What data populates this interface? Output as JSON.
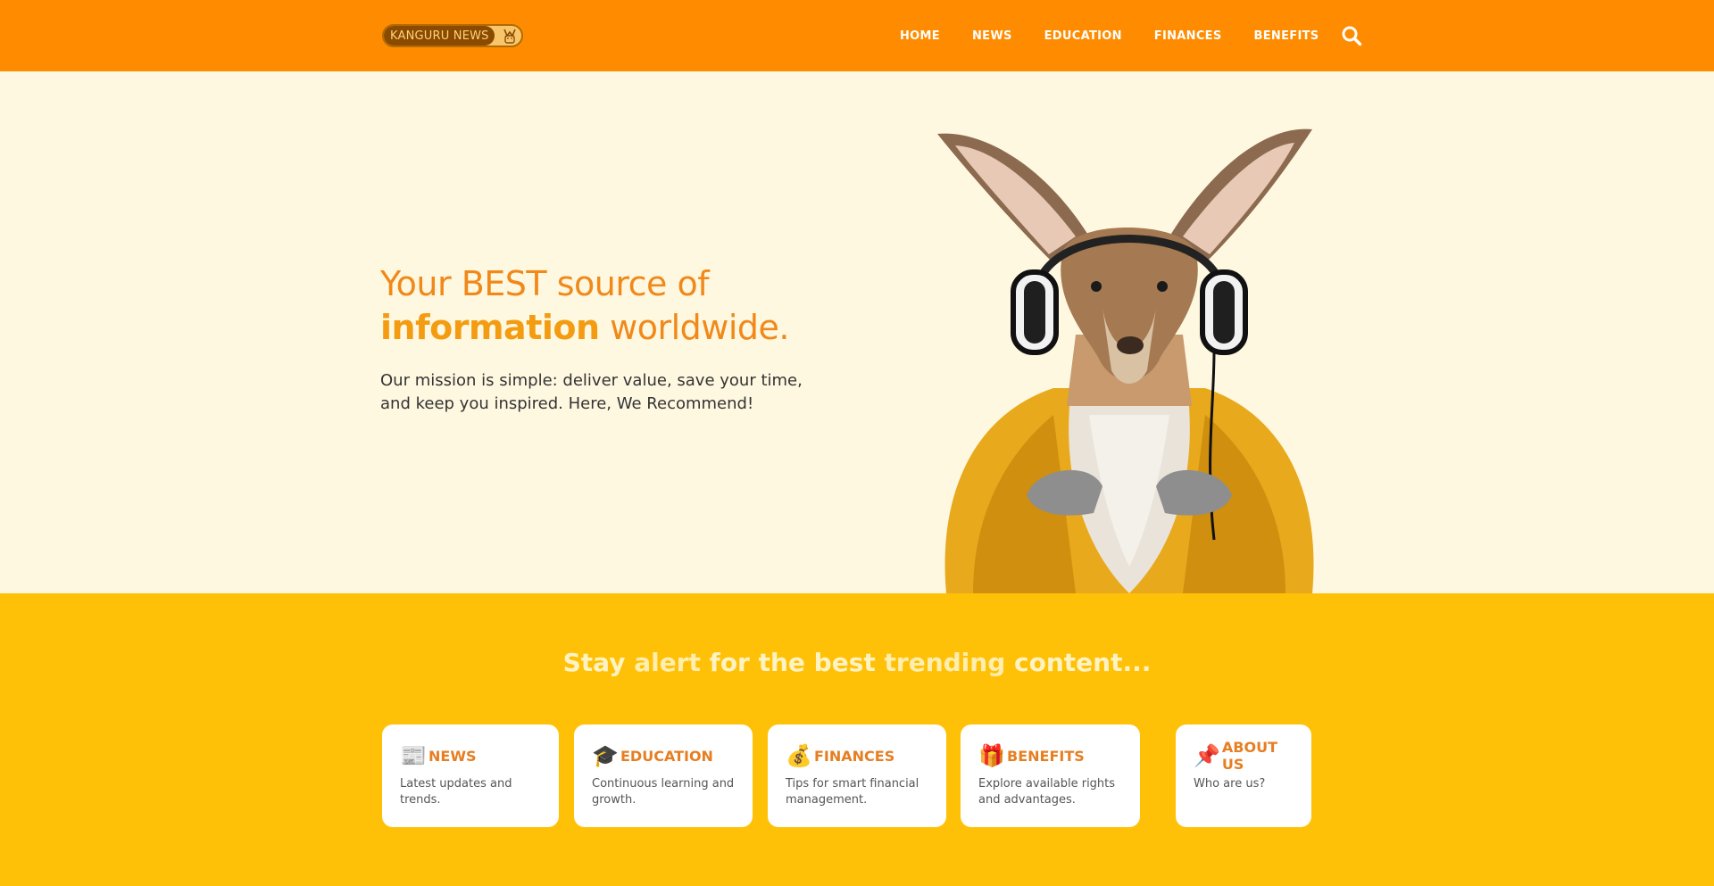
{
  "header": {
    "logo_text": "KANGURU NEWS",
    "nav": [
      {
        "label": "HOME"
      },
      {
        "label": "NEWS"
      },
      {
        "label": "EDUCATION"
      },
      {
        "label": "FINANCES"
      },
      {
        "label": "BENEFITS"
      }
    ],
    "search_icon": "search-icon"
  },
  "hero": {
    "title_part1": "Your BEST source of",
    "title_highlight": "information",
    "title_part2": "worldwide.",
    "text": "Our mission is simple: deliver value, save your time, and keep you inspired. Here, We Recommend!"
  },
  "trending": {
    "title_part1": "Stay",
    "title_bold1": "alert",
    "title_part2": "for the best",
    "title_bold2": "trending",
    "title_part3": "content..."
  },
  "cards": [
    {
      "icon": "newspaper-icon",
      "glyph": "📰",
      "title": "NEWS",
      "desc": "Latest updates and trends."
    },
    {
      "icon": "graduation-cap-icon",
      "glyph": "🎓",
      "title": "EDUCATION",
      "desc": "Continuous learning and growth."
    },
    {
      "icon": "money-bag-icon",
      "glyph": "💰",
      "title": "FINANCES",
      "desc": "Tips for smart financial management."
    },
    {
      "icon": "gift-icon",
      "glyph": "🎁",
      "title": "BENEFITS",
      "desc": "Explore available rights and advantages."
    },
    {
      "icon": "pushpin-icon",
      "glyph": "📌",
      "title": "ABOUT US",
      "desc": "Who are us?"
    }
  ],
  "colors": {
    "header_bg": "#ff8c00",
    "hero_bg": "#fff8e1",
    "section_bg": "#ffc107",
    "accent": "#f0891a"
  }
}
